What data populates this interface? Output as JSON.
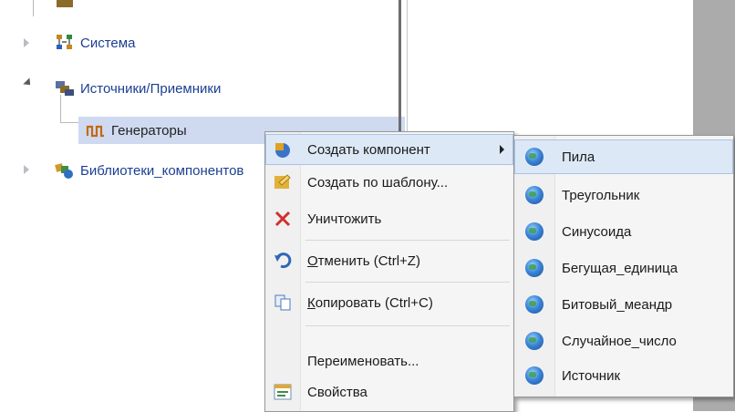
{
  "tree": {
    "items": [
      {
        "label": "Система",
        "icon": "system-network-icon"
      },
      {
        "label": "Источники/Приемники",
        "icon": "sources-receivers-icon"
      },
      {
        "label": "Генераторы",
        "icon": "generator-signal-icon"
      },
      {
        "label": "Библиотеки_компонентов",
        "icon": "component-library-icon"
      }
    ]
  },
  "context_menu": {
    "items": [
      {
        "label": "Создать компонент",
        "icon": "create-component-icon",
        "has_submenu": true
      },
      {
        "label": "Создать по шаблону...",
        "icon": "create-from-template-icon"
      },
      {
        "label": "Уничтожить",
        "icon": "delete-x-icon"
      },
      {
        "label_underlined": "О",
        "label_rest": "тменить (Ctrl+Z)",
        "icon": "undo-icon"
      },
      {
        "label_underlined": "К",
        "label_rest": "опировать (Ctrl+C)",
        "icon": "copy-icon"
      },
      {
        "label": "Переименовать...",
        "icon": ""
      },
      {
        "label": "Свойства",
        "icon": "properties-icon"
      }
    ]
  },
  "submenu": {
    "items": [
      {
        "label": "Пила",
        "icon": "globe-icon"
      },
      {
        "label": "Треугольник",
        "icon": "globe-icon"
      },
      {
        "label": "Синусоида",
        "icon": "globe-icon"
      },
      {
        "label": "Бегущая_единица",
        "icon": "globe-icon"
      },
      {
        "label": "Битовый_меандр",
        "icon": "globe-icon"
      },
      {
        "label": "Случайное_число",
        "icon": "globe-icon"
      },
      {
        "label": "Источник",
        "icon": "globe-icon"
      }
    ]
  },
  "colors": {
    "tree_label": "#1c3f93",
    "selection": "#cfdaf0",
    "menu_highlight": "#dde8f6",
    "delete_red": "#d0312d"
  }
}
